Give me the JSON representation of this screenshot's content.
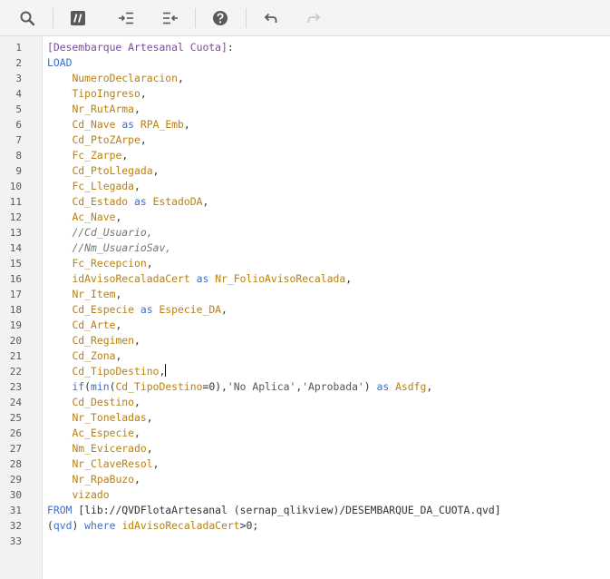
{
  "toolbar": {
    "buttons": [
      {
        "name": "search-button",
        "icon": "search-icon",
        "enabled": true
      },
      {
        "name": "comment-button",
        "icon": "comment-toggle-icon",
        "enabled": true
      },
      {
        "name": "indent-button",
        "icon": "indent-icon",
        "enabled": true
      },
      {
        "name": "outdent-button",
        "icon": "outdent-icon",
        "enabled": true
      },
      {
        "name": "help-button",
        "icon": "help-icon",
        "enabled": true
      },
      {
        "name": "undo-button",
        "icon": "undo-icon",
        "enabled": true
      },
      {
        "name": "redo-button",
        "icon": "redo-icon",
        "enabled": false
      }
    ]
  },
  "colors": {
    "field": "#b9800f",
    "keyword": "#3a6fd1",
    "comment": "#757575",
    "label": "#7c4a9e",
    "text": "#333333"
  },
  "editor": {
    "cursor_line": 22,
    "lines": [
      {
        "n": "1",
        "tokens": [
          [
            "tablelabel",
            "[Desembarque Artesanal Cuota]"
          ],
          [
            "punct",
            ":"
          ]
        ]
      },
      {
        "n": "2",
        "tokens": [
          [
            "kw",
            "LOAD"
          ]
        ]
      },
      {
        "n": "3",
        "tokens": [
          [
            "plain",
            "    "
          ],
          [
            "field",
            "NumeroDeclaracion"
          ],
          [
            "punct",
            ","
          ]
        ]
      },
      {
        "n": "4",
        "tokens": [
          [
            "plain",
            "    "
          ],
          [
            "field",
            "TipoIngreso"
          ],
          [
            "punct",
            ","
          ]
        ]
      },
      {
        "n": "5",
        "tokens": [
          [
            "plain",
            "    "
          ],
          [
            "field",
            "Nr_RutArma"
          ],
          [
            "punct",
            ","
          ]
        ]
      },
      {
        "n": "6",
        "tokens": [
          [
            "plain",
            "    "
          ],
          [
            "field",
            "Cd_Nave"
          ],
          [
            "plain",
            " "
          ],
          [
            "kw",
            "as"
          ],
          [
            "plain",
            " "
          ],
          [
            "field",
            "RPA_Emb"
          ],
          [
            "punct",
            ","
          ]
        ]
      },
      {
        "n": "7",
        "tokens": [
          [
            "plain",
            "    "
          ],
          [
            "field",
            "Cd_PtoZArpe"
          ],
          [
            "punct",
            ","
          ]
        ]
      },
      {
        "n": "8",
        "tokens": [
          [
            "plain",
            "    "
          ],
          [
            "field",
            "Fc_Zarpe"
          ],
          [
            "punct",
            ","
          ]
        ]
      },
      {
        "n": "9",
        "tokens": [
          [
            "plain",
            "    "
          ],
          [
            "field",
            "Cd_PtoLlegada"
          ],
          [
            "punct",
            ","
          ]
        ]
      },
      {
        "n": "10",
        "tokens": [
          [
            "plain",
            "    "
          ],
          [
            "field",
            "Fc_Llegada"
          ],
          [
            "punct",
            ","
          ]
        ]
      },
      {
        "n": "11",
        "tokens": [
          [
            "plain",
            "    "
          ],
          [
            "field",
            "Cd_Estado"
          ],
          [
            "plain",
            " "
          ],
          [
            "kw",
            "as"
          ],
          [
            "plain",
            " "
          ],
          [
            "field",
            "EstadoDA"
          ],
          [
            "punct",
            ","
          ]
        ]
      },
      {
        "n": "12",
        "tokens": [
          [
            "plain",
            "    "
          ],
          [
            "field",
            "Ac_Nave"
          ],
          [
            "punct",
            ","
          ]
        ]
      },
      {
        "n": "13",
        "tokens": [
          [
            "plain",
            "    "
          ],
          [
            "comment",
            "//Cd_Usuario,"
          ]
        ]
      },
      {
        "n": "14",
        "tokens": [
          [
            "plain",
            "    "
          ],
          [
            "comment",
            "//Nm_UsuarioSav,"
          ]
        ]
      },
      {
        "n": "15",
        "tokens": [
          [
            "plain",
            "    "
          ],
          [
            "field",
            "Fc_Recepcion"
          ],
          [
            "punct",
            ","
          ]
        ]
      },
      {
        "n": "16",
        "tokens": [
          [
            "plain",
            "    "
          ],
          [
            "field",
            "idAvisoRecaladaCert"
          ],
          [
            "plain",
            " "
          ],
          [
            "kw",
            "as"
          ],
          [
            "plain",
            " "
          ],
          [
            "field",
            "Nr_FolioAvisoRecalada"
          ],
          [
            "punct",
            ","
          ]
        ]
      },
      {
        "n": "17",
        "tokens": [
          [
            "plain",
            "    "
          ],
          [
            "field",
            "Nr_Item"
          ],
          [
            "punct",
            ","
          ]
        ]
      },
      {
        "n": "18",
        "tokens": [
          [
            "plain",
            "    "
          ],
          [
            "field",
            "Cd_Especie"
          ],
          [
            "plain",
            " "
          ],
          [
            "kw",
            "as"
          ],
          [
            "plain",
            " "
          ],
          [
            "field",
            "Especie_DA"
          ],
          [
            "punct",
            ","
          ]
        ]
      },
      {
        "n": "19",
        "tokens": [
          [
            "plain",
            "    "
          ],
          [
            "field",
            "Cd_Arte"
          ],
          [
            "punct",
            ","
          ]
        ]
      },
      {
        "n": "20",
        "tokens": [
          [
            "plain",
            "    "
          ],
          [
            "field",
            "Cd_Regimen"
          ],
          [
            "punct",
            ","
          ]
        ]
      },
      {
        "n": "21",
        "tokens": [
          [
            "plain",
            "    "
          ],
          [
            "field",
            "Cd_Zona"
          ],
          [
            "punct",
            ","
          ]
        ]
      },
      {
        "n": "22",
        "tokens": [
          [
            "plain",
            "    "
          ],
          [
            "field",
            "Cd_TipoDestino"
          ],
          [
            "punct",
            ","
          ]
        ]
      },
      {
        "n": "23",
        "tokens": [
          [
            "plain",
            "    "
          ],
          [
            "kw",
            "if"
          ],
          [
            "punct",
            "("
          ],
          [
            "fn",
            "min"
          ],
          [
            "punct",
            "("
          ],
          [
            "field",
            "Cd_TipoDestino"
          ],
          [
            "op",
            "="
          ],
          [
            "num",
            "0"
          ],
          [
            "punct",
            "),"
          ],
          [
            "str",
            "'No Aplica'"
          ],
          [
            "punct",
            ","
          ],
          [
            "str",
            "'Aprobada'"
          ],
          [
            "punct",
            ")"
          ],
          [
            "plain",
            " "
          ],
          [
            "kw",
            "as"
          ],
          [
            "plain",
            " "
          ],
          [
            "field",
            "Asdfg"
          ],
          [
            "punct",
            ","
          ]
        ]
      },
      {
        "n": "24",
        "tokens": [
          [
            "plain",
            "    "
          ],
          [
            "field",
            "Cd_Destino"
          ],
          [
            "punct",
            ","
          ]
        ]
      },
      {
        "n": "25",
        "tokens": [
          [
            "plain",
            "    "
          ],
          [
            "field",
            "Nr_Toneladas"
          ],
          [
            "punct",
            ","
          ]
        ]
      },
      {
        "n": "26",
        "tokens": [
          [
            "plain",
            "    "
          ],
          [
            "field",
            "Ac_Especie"
          ],
          [
            "punct",
            ","
          ]
        ]
      },
      {
        "n": "27",
        "tokens": [
          [
            "plain",
            "    "
          ],
          [
            "field",
            "Nm_Evicerado"
          ],
          [
            "punct",
            ","
          ]
        ]
      },
      {
        "n": "28",
        "tokens": [
          [
            "plain",
            "    "
          ],
          [
            "field",
            "Nr_ClaveResol"
          ],
          [
            "punct",
            ","
          ]
        ]
      },
      {
        "n": "29",
        "tokens": [
          [
            "plain",
            "    "
          ],
          [
            "field",
            "Nr_RpaBuzo"
          ],
          [
            "punct",
            ","
          ]
        ]
      },
      {
        "n": "30",
        "tokens": [
          [
            "plain",
            "    "
          ],
          [
            "field",
            "vizado"
          ]
        ]
      },
      {
        "n": "31",
        "tokens": [
          [
            "kw",
            "FROM"
          ],
          [
            "plain",
            " "
          ],
          [
            "path",
            "[lib://QVDFlotaArtesanal (sernap_qlikview)/DESEMBARQUE_DA_CUOTA.qvd]"
          ]
        ]
      },
      {
        "n": "32",
        "tokens": [
          [
            "punct",
            "("
          ],
          [
            "kw",
            "qvd"
          ],
          [
            "punct",
            ")"
          ],
          [
            "plain",
            " "
          ],
          [
            "kw",
            "where"
          ],
          [
            "plain",
            " "
          ],
          [
            "field",
            "idAvisoRecaladaCert"
          ],
          [
            "op",
            ">"
          ],
          [
            "num",
            "0"
          ],
          [
            "punct",
            ";"
          ]
        ]
      },
      {
        "n": "33",
        "tokens": []
      }
    ]
  }
}
